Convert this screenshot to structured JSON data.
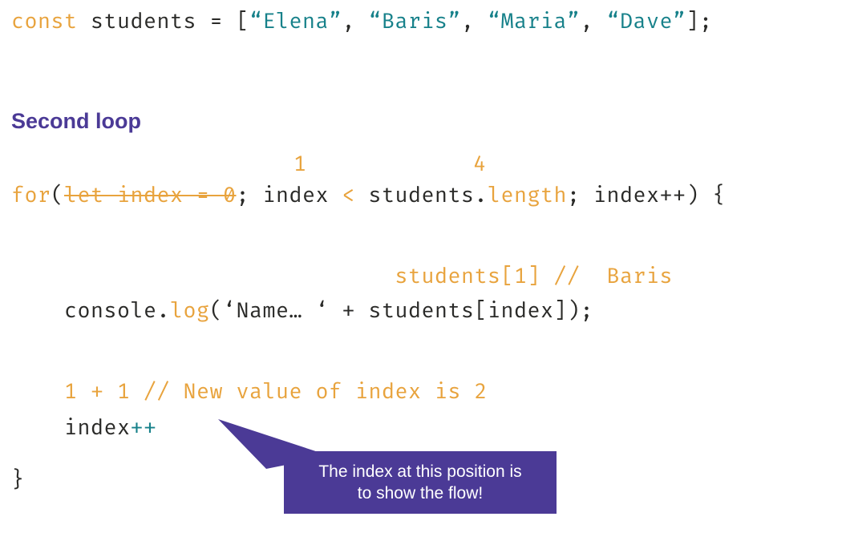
{
  "decl": {
    "kw": "const",
    "var": "students",
    "eq": " = ",
    "lb": "[",
    "items": [
      "“Elena”",
      "“Baris”",
      "“Maria”",
      "“Dave”"
    ],
    "sep": ", ",
    "rb": "]",
    "semi": ";"
  },
  "heading": "Second loop",
  "annot_values": {
    "one": "1",
    "four": "4"
  },
  "forline": {
    "kw": "for",
    "open": "(",
    "struck": "let index = 0",
    "semi1": "; ",
    "cond_lhs": "index",
    "lt": " < ",
    "cond_rhs_obj": "students",
    "dot": ".",
    "cond_rhs_prop": "length",
    "semi2": "; ",
    "inc": "index++",
    "close": ") {"
  },
  "body_annot1": "students[1] //  Baris",
  "logline": {
    "indent": "    ",
    "obj": "console",
    "dot": ".",
    "fn": "log",
    "open": "(",
    "str": "‘Name… ‘",
    "plus": " + ",
    "arg": "students[index]",
    "close": ");"
  },
  "body_annot2": "    1 + 1 // New value of index is 2",
  "incline": {
    "indent": "    ",
    "var": "index",
    "op": "++"
  },
  "closebrace": "}",
  "callout": {
    "line1": "The index at this position is",
    "line2": "to show the flow!"
  }
}
